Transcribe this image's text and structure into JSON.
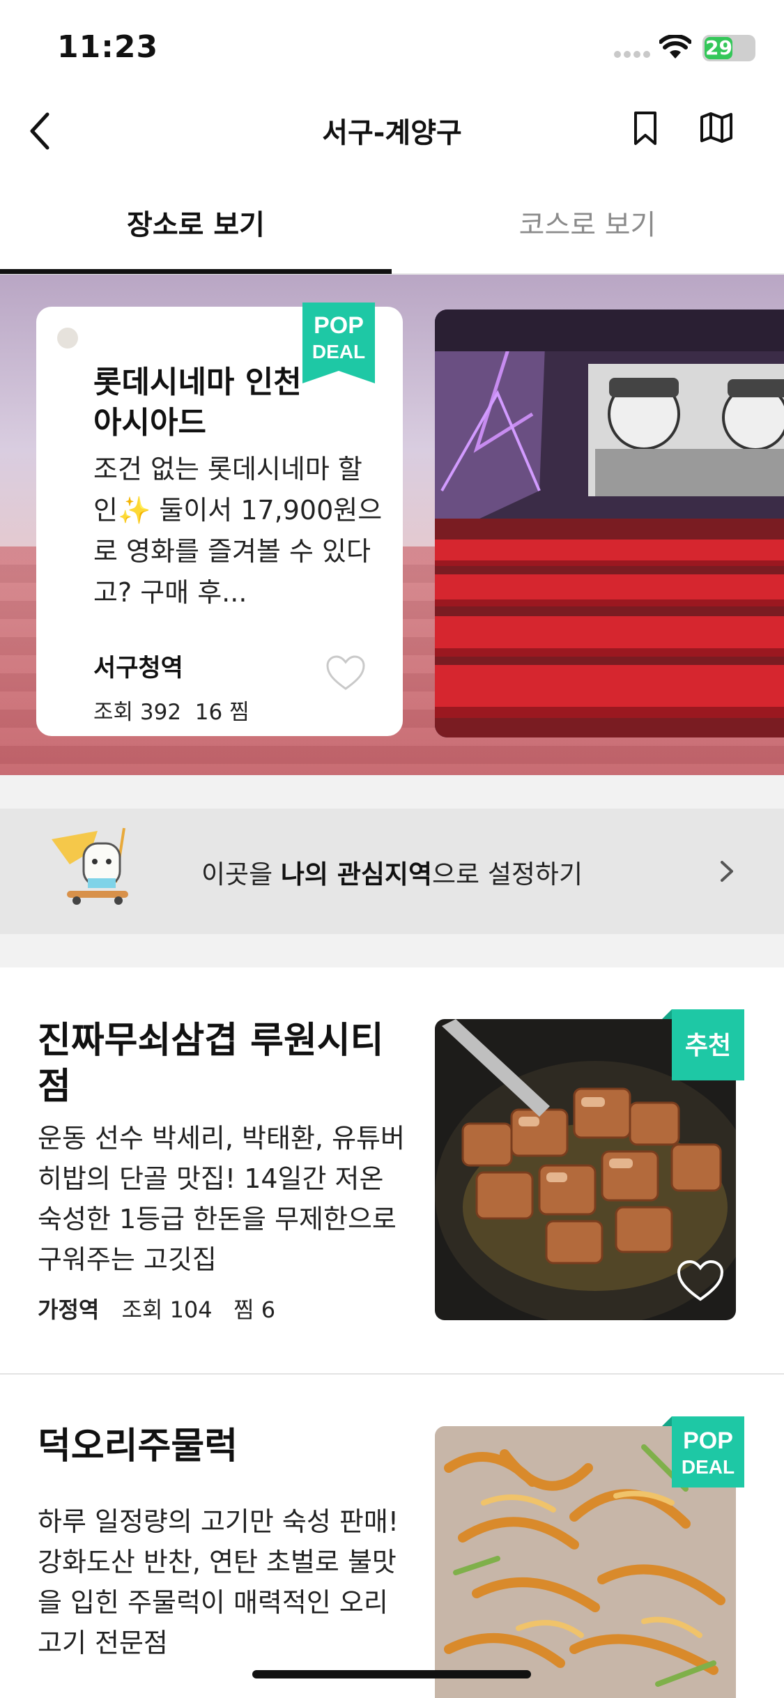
{
  "status_bar": {
    "time": "11:23",
    "battery": "29"
  },
  "nav": {
    "title": "서구-계양구"
  },
  "tabs": [
    {
      "label": "장소로 보기",
      "active": true
    },
    {
      "label": "코스로 보기",
      "active": false
    }
  ],
  "featured": {
    "badge_line1": "POP",
    "badge_line2": "DEAL",
    "title": "롯데시네마 인천아시아드",
    "description": "조건 없는 롯데시네마 할인✨ 둘이서 17,900원으로 영화를 즐겨볼 수 있다고? 구매 후...",
    "location": "서구청역",
    "views_label": "조회",
    "views": "392",
    "likes": "16",
    "likes_label": "찜"
  },
  "interest_banner": {
    "prefix": "이곳을 ",
    "bold": "나의 관심지역",
    "suffix": "으로 설정하기"
  },
  "list": [
    {
      "title": "진짜무쇠삼겹 루원시티점",
      "description": "운동 선수 박세리, 박태환, 유튜버 히밥의 단골 맛집! 14일간 저온 숙성한 1등급 한돈을 무제한으로 구워주는 고깃집",
      "location": "가정역",
      "views_label": "조회",
      "views": "104",
      "likes_label": "찜",
      "likes": "6",
      "badge": "추천"
    },
    {
      "title": "덕오리주물럭",
      "description": "하루 일정량의 고기만 숙성 판매! 강화도산 반찬, 연탄 초벌로 불맛을 입힌 주물럭이 매력적인 오리고기 전문점",
      "badge_line1": "POP",
      "badge_line2": "DEAL"
    }
  ],
  "colors": {
    "accent": "#1ec8a5",
    "text": "#111111",
    "muted": "#8a8a8a"
  },
  "icons": [
    "back-icon",
    "bookmark-icon",
    "map-icon",
    "heart-icon",
    "chevron-right-icon",
    "wifi-icon",
    "signal-icon"
  ]
}
